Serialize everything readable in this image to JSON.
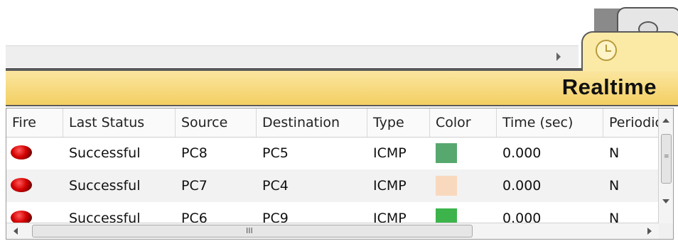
{
  "mode": {
    "title": "Realtime",
    "realtime_icon": "clock-icon",
    "simulation_icon": "stopwatch-icon"
  },
  "table": {
    "columns": [
      "Fire",
      "Last Status",
      "Source",
      "Destination",
      "Type",
      "Color",
      "Time (sec)",
      "Periodic"
    ],
    "rows": [
      {
        "fire": "red-light-icon",
        "last_status": "Successful",
        "source": "PC8",
        "destination": "PC5",
        "type": "ICMP",
        "color": "#56a86e",
        "time": "0.000",
        "periodic": "N"
      },
      {
        "fire": "red-light-icon",
        "last_status": "Successful",
        "source": "PC7",
        "destination": "PC4",
        "type": "ICMP",
        "color": "#f9d9bd",
        "time": "0.000",
        "periodic": "N"
      },
      {
        "fire": "red-light-icon",
        "last_status": "Successful",
        "source": "PC6",
        "destination": "PC9",
        "type": "ICMP",
        "color": "#3cb44b",
        "time": "0.000",
        "periodic": "N"
      }
    ]
  },
  "scrollbar": {
    "horizontal_grip": "III"
  }
}
